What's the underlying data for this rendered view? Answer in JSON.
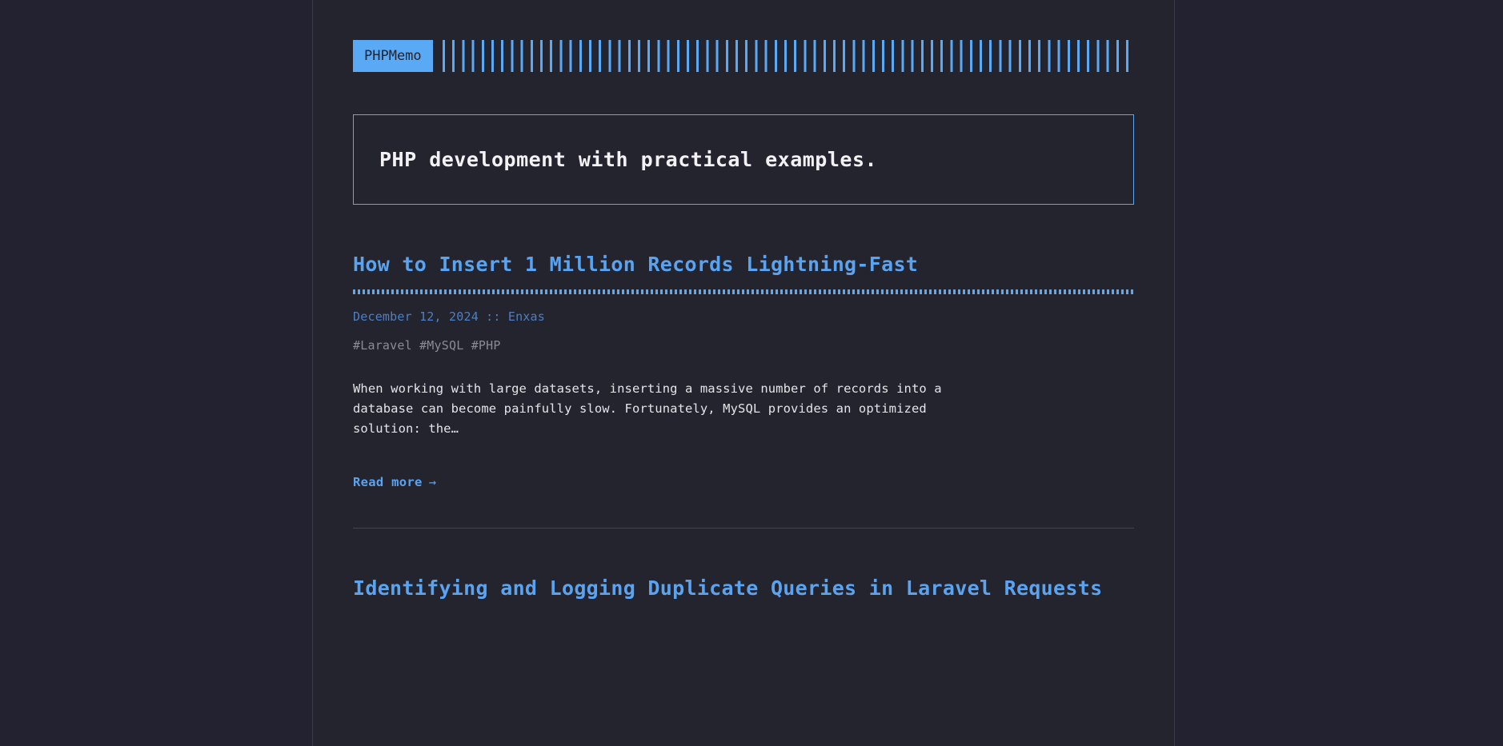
{
  "site": {
    "logo_text": "PHPMemo",
    "tagline": "PHP development with practical examples.",
    "accent_color": "#5aa9f5",
    "title_color": "#5aa3f0",
    "background_color": "#222230",
    "container_color": "#24242f"
  },
  "posts": [
    {
      "title": "How to Insert 1 Million Records Lightning-Fast",
      "meta": "December 12, 2024 :: Enxas",
      "tags": "#Laravel #MySQL #PHP",
      "excerpt": "When working with large datasets, inserting a massive number of records into a database can become painfully slow. Fortunately, MySQL provides an optimized solution: the…",
      "read_more_label": "Read more",
      "read_more_arrow": "→"
    },
    {
      "title": "Identifying and Logging Duplicate Queries in Laravel Requests",
      "meta": "",
      "tags": "",
      "excerpt": "",
      "read_more_label": "",
      "read_more_arrow": ""
    }
  ]
}
